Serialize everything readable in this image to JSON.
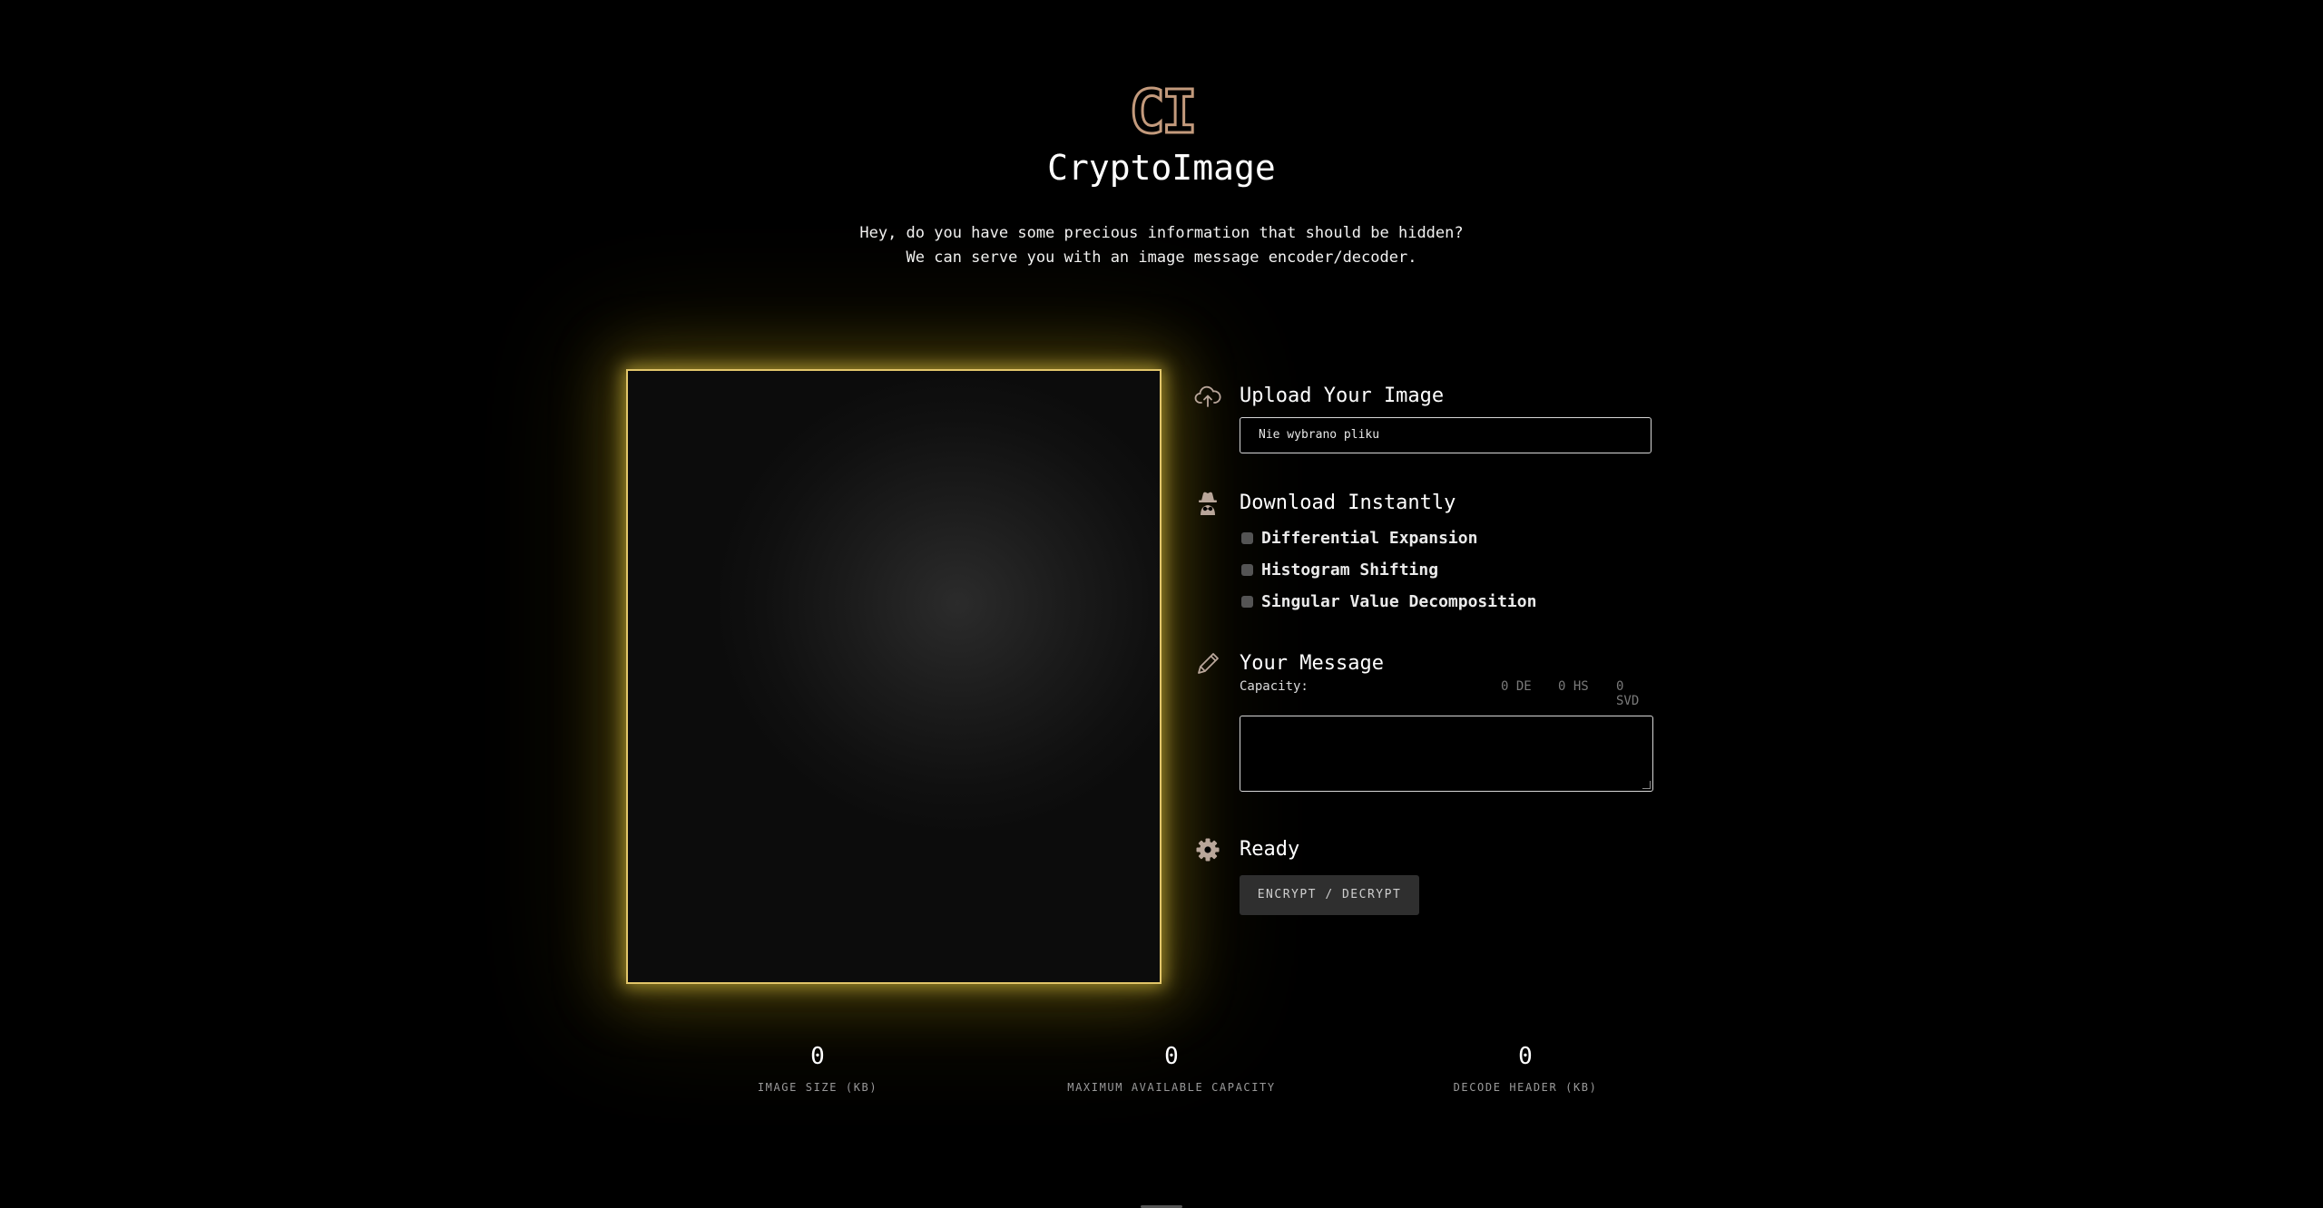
{
  "header": {
    "logo_text": "CI",
    "title": "CryptoImage",
    "subtitle_line1": "Hey, do you have some precious information that should be hidden?",
    "subtitle_line2": "We can serve you with an image message encoder/decoder."
  },
  "colors": {
    "accent_gold": "#e2c66a",
    "logo_outline": "#c39a7c",
    "icon_gray": "#b9a69a"
  },
  "upload": {
    "icon": "cloud-upload-icon",
    "title": "Upload Your Image",
    "file_status": "Nie wybrano pliku"
  },
  "download": {
    "icon": "incognito-icon",
    "title": "Download Instantly",
    "options": [
      {
        "label": "Differential Expansion",
        "checked": false
      },
      {
        "label": "Histogram Shifting",
        "checked": false
      },
      {
        "label": "Singular Value Decomposition",
        "checked": false
      }
    ]
  },
  "message": {
    "icon": "pencil-icon",
    "title": "Your Message",
    "capacity_label": "Capacity:",
    "capacity_de": "0 DE",
    "capacity_hs": "0 HS",
    "capacity_svd": "0 SVD",
    "text": ""
  },
  "status": {
    "icon": "gear-icon",
    "title": "Ready",
    "button_label": "ENCRYPT / DECRYPT"
  },
  "stats": [
    {
      "value": "0",
      "label": "IMAGE SIZE (KB)"
    },
    {
      "value": "0",
      "label": "MAXIMUM AVAILABLE CAPACITY"
    },
    {
      "value": "0",
      "label": "DECODE HEADER (KB)"
    }
  ]
}
